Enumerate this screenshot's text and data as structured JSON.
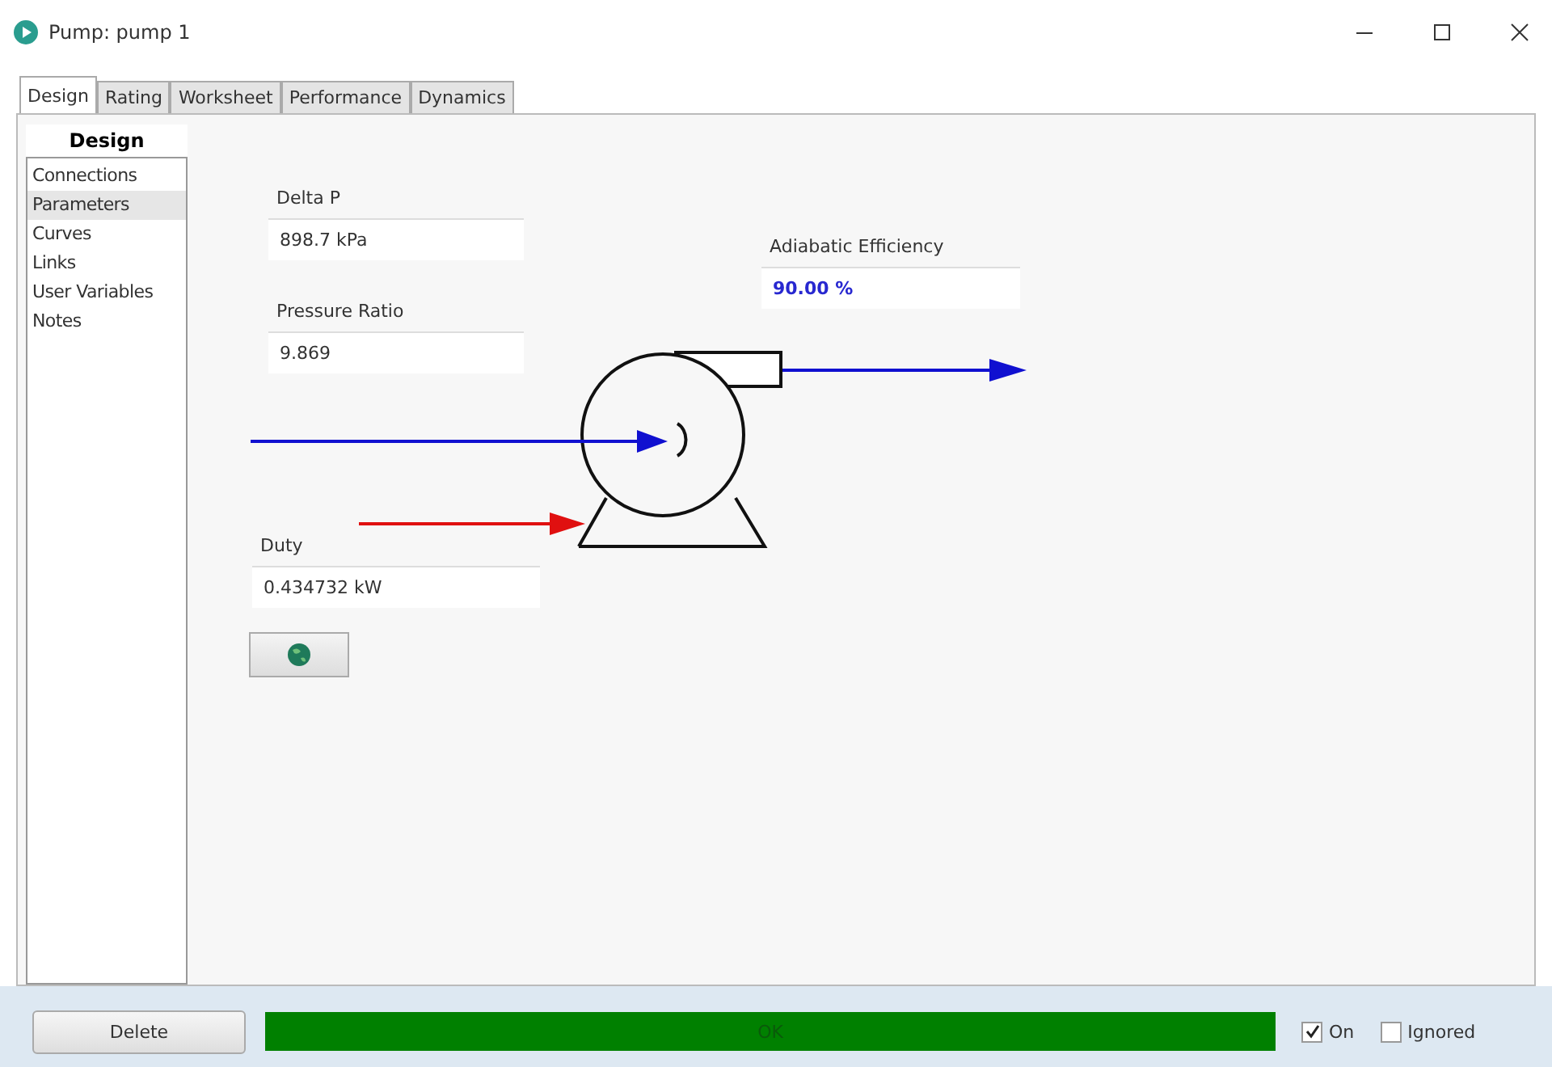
{
  "window": {
    "title": "Pump: pump 1"
  },
  "tabs": [
    {
      "label": "Design",
      "selected": true
    },
    {
      "label": "Rating",
      "selected": false
    },
    {
      "label": "Worksheet",
      "selected": false
    },
    {
      "label": "Performance",
      "selected": false
    },
    {
      "label": "Dynamics",
      "selected": false
    }
  ],
  "sidebar": {
    "header": "Design",
    "items": [
      {
        "label": "Connections",
        "selected": false
      },
      {
        "label": "Parameters",
        "selected": true
      },
      {
        "label": "Curves",
        "selected": false
      },
      {
        "label": "Links",
        "selected": false
      },
      {
        "label": "User Variables",
        "selected": false
      },
      {
        "label": "Notes",
        "selected": false
      }
    ]
  },
  "fields": [
    {
      "label": "Delta P",
      "value": "898.7 kPa",
      "highlighted": false
    },
    {
      "label": "Pressure Ratio",
      "value": "9.869",
      "highlighted": false
    },
    {
      "label": "Adiabatic Efficiency",
      "value": "90.00 %",
      "highlighted": true
    },
    {
      "label": "Duty",
      "value": "0.434732 kW",
      "highlighted": false
    }
  ],
  "footer": {
    "delete_button": "Delete",
    "status": {
      "label": "OK",
      "kind": "ok"
    },
    "checkboxes": [
      {
        "label": "On",
        "checked": true
      },
      {
        "label": "Ignored",
        "checked": false
      }
    ]
  }
}
